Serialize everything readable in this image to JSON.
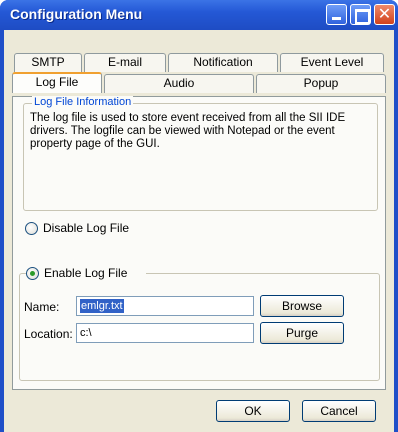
{
  "window": {
    "title": "Configuration Menu",
    "close_glyph": "✕"
  },
  "tabs_row1": [
    {
      "label": "SMTP"
    },
    {
      "label": "E-mail"
    },
    {
      "label": "Notification"
    },
    {
      "label": "Event Level"
    }
  ],
  "tabs_row2": [
    {
      "label": "Log File",
      "active": true
    },
    {
      "label": "Audio"
    },
    {
      "label": "Popup"
    }
  ],
  "log_info": {
    "legend": "Log File Information",
    "description": "The log file is used to store event received from all the SII IDE drivers. The logfile can be viewed with Notepad or the event property page of the GUI."
  },
  "options": {
    "disable_label": "Disable Log File",
    "enable_label": "Enable  Log File",
    "selected": "enable"
  },
  "fields": {
    "name_label": "Name:",
    "name_value": "emlgr.txt",
    "location_label": "Location:",
    "location_value": "c:\\",
    "browse_label": "Browse",
    "purge_label": "Purge"
  },
  "footer": {
    "ok_label": "OK",
    "cancel_label": "Cancel"
  },
  "colors": {
    "titlebar": "#2458d6",
    "client_bg": "#ece9d8",
    "legend_text": "#0046d5",
    "active_tab_accent": "#f0a030"
  }
}
